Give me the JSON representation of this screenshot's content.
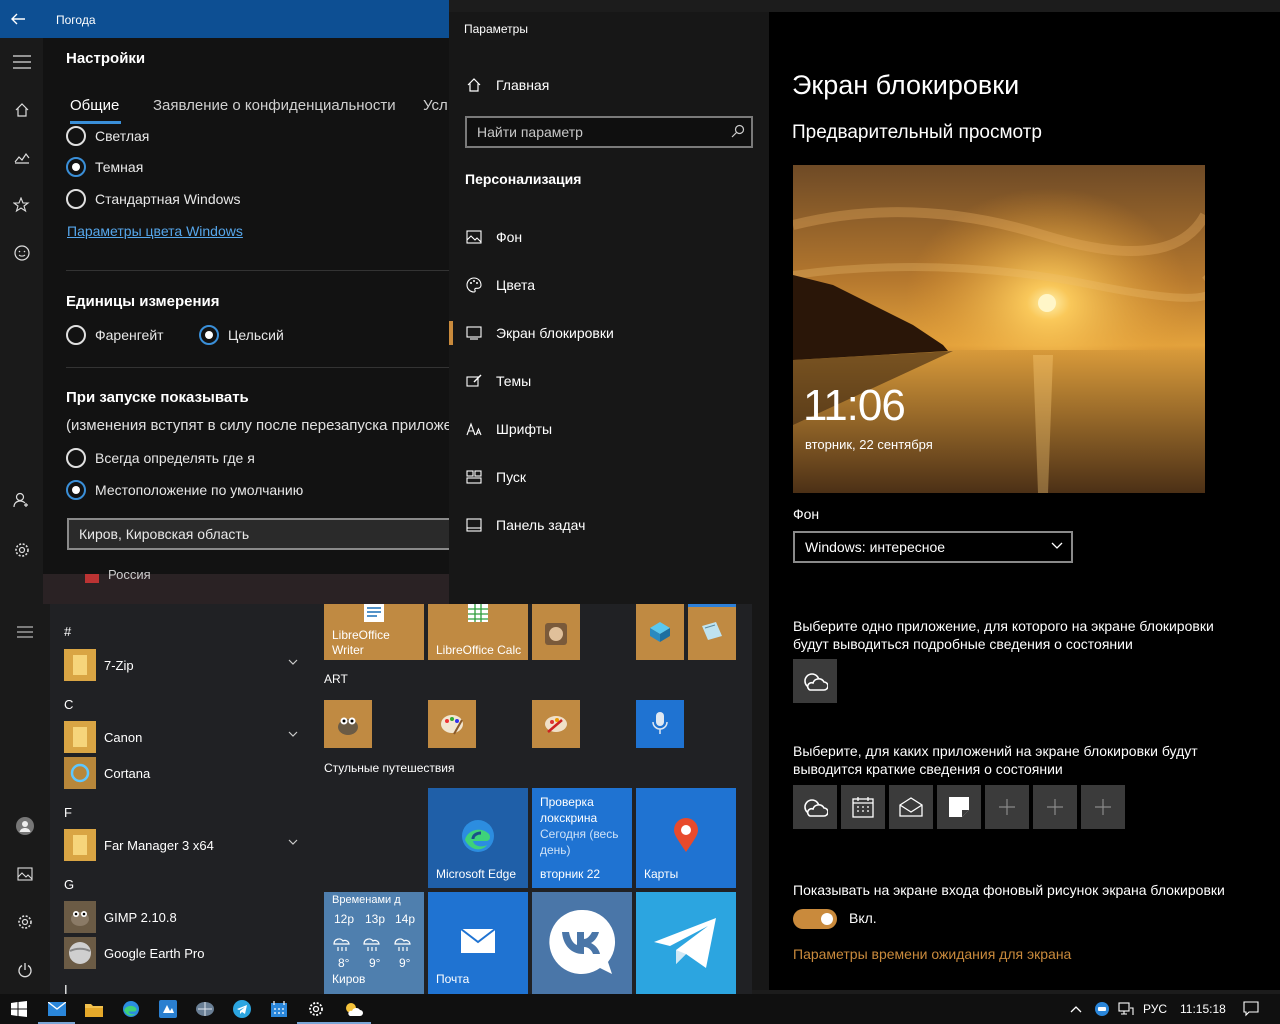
{
  "weather": {
    "title": "Погода",
    "heading": "Настройки",
    "tabs": [
      "Общие",
      "Заявление о конфиденциальности",
      "Усл"
    ],
    "theme_options": [
      "Светлая",
      "Темная",
      "Стандартная Windows"
    ],
    "theme_selected": "Темная",
    "color_link": "Параметры цвета Windows",
    "units_heading": "Единицы измерения",
    "units": [
      "Фаренгейт",
      "Цельсий"
    ],
    "units_selected": "Цельсий",
    "startup_heading": "При запуске показывать",
    "startup_note": "(изменения вступят в силу после перезапуска приложе",
    "startup_options": [
      "Всегда определять где я",
      "Местоположение по умолчанию"
    ],
    "startup_selected": "Местоположение по умолчанию",
    "location_value": "Киров, Кировская область",
    "behind_text": "Россия"
  },
  "settings": {
    "app_title": "Параметры",
    "home": "Главная",
    "search_placeholder": "Найти параметр",
    "section": "Персонализация",
    "nav": [
      "Фон",
      "Цвета",
      "Экран блокировки",
      "Темы",
      "Шрифты",
      "Пуск",
      "Панель задач"
    ],
    "nav_active": "Экран блокировки",
    "page_title": "Экран блокировки",
    "preview_heading": "Предварительный просмотр",
    "preview_time": "11:06",
    "preview_date": "вторник, 22 сентября",
    "background_label": "Фон",
    "background_value": "Windows: интересное",
    "detailed_app_text": "Выберите одно приложение, для которого на экране блокировки будут выводиться подробные сведения о состоянии",
    "quick_apps_text": "Выберите, для каких приложений на экране блокировки будут выводится краткие сведения о состоянии",
    "signin_bg_text": "Показывать на экране входа фоновый рисунок экрана блокировки",
    "toggle_label": "Вкл.",
    "timeout_link": "Параметры времени ожидания для экрана",
    "accent_color": "#c98a3c"
  },
  "start": {
    "list": [
      {
        "type": "letter",
        "text": "#"
      },
      {
        "type": "app",
        "text": "7-Zip",
        "icon": "folder-icon",
        "expandable": true
      },
      {
        "type": "letter",
        "text": "C"
      },
      {
        "type": "app",
        "text": "Canon",
        "icon": "folder-icon",
        "expandable": true
      },
      {
        "type": "app",
        "text": "Cortana",
        "icon": "cortana-icon",
        "expandable": false
      },
      {
        "type": "letter",
        "text": "F"
      },
      {
        "type": "app",
        "text": "Far Manager 3 x64",
        "icon": "folder-icon",
        "expandable": true
      },
      {
        "type": "letter",
        "text": "G"
      },
      {
        "type": "app",
        "text": "GIMP 2.10.8",
        "icon": "gimp-icon",
        "expandable": false
      },
      {
        "type": "app",
        "text": "Google Earth Pro",
        "icon": "google-earth-icon",
        "expandable": false
      },
      {
        "type": "letter",
        "text": "I"
      }
    ],
    "tiles_top": [
      "LibreOffice Writer",
      "LibreOffice Calc"
    ],
    "group_art": "ART",
    "group_travel": "Стульные путешествия",
    "edge": "Microsoft Edge",
    "lockscreen_tile_title": "Проверка локскрина",
    "lockscreen_tile_sub": "Сегодня (весь день)",
    "lockscreen_tile_date": "вторник 22",
    "maps": "Карты",
    "weather_tile_title": "Временами д",
    "weather_hours": [
      "12р",
      "13р",
      "14р"
    ],
    "weather_temps": [
      "8°",
      "9°",
      "9°"
    ],
    "weather_city": "Киров",
    "mail": "Почта"
  },
  "taskbar": {
    "lang": "РУС",
    "time": "11:15:18"
  }
}
